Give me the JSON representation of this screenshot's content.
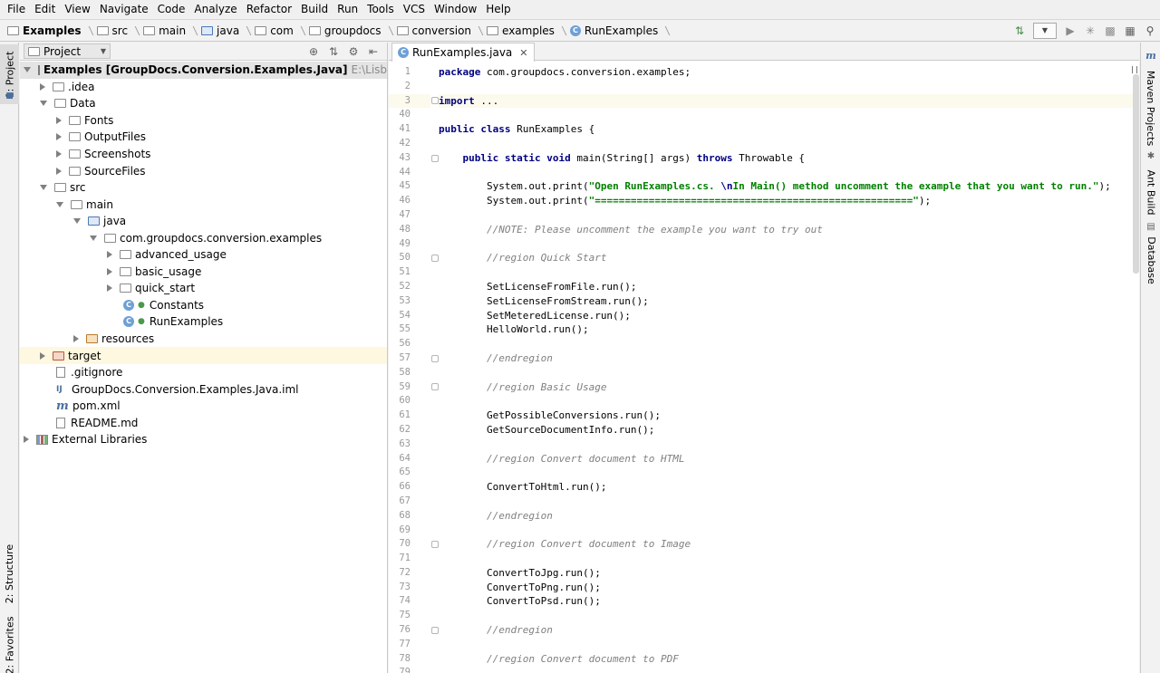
{
  "menu": [
    "File",
    "Edit",
    "View",
    "Navigate",
    "Code",
    "Analyze",
    "Refactor",
    "Build",
    "Run",
    "Tools",
    "VCS",
    "Window",
    "Help"
  ],
  "breadcrumbs": [
    "Examples",
    "src",
    "main",
    "java",
    "com",
    "groupdocs",
    "conversion",
    "examples",
    "RunExamples"
  ],
  "left_tabs": {
    "project": "1: Project",
    "structure": "2: Structure",
    "favorites": "2: Favorites"
  },
  "right_tabs": {
    "maven": "Maven Projects",
    "ant": "Ant Build",
    "database": "Database"
  },
  "project_panel": {
    "view": "Project"
  },
  "tree": [
    {
      "label": "Examples [GroupDocs.Conversion.Examples.Java]",
      "path": "E:\\Lisbon\\Java_product"
    },
    {
      "label": ".idea"
    },
    {
      "label": "Data"
    },
    {
      "label": "Fonts"
    },
    {
      "label": "OutputFiles"
    },
    {
      "label": "Screenshots"
    },
    {
      "label": "SourceFiles"
    },
    {
      "label": "src"
    },
    {
      "label": "main"
    },
    {
      "label": "java"
    },
    {
      "label": "com.groupdocs.conversion.examples"
    },
    {
      "label": "advanced_usage"
    },
    {
      "label": "basic_usage"
    },
    {
      "label": "quick_start"
    },
    {
      "label": "Constants"
    },
    {
      "label": "RunExamples"
    },
    {
      "label": "resources"
    },
    {
      "label": "target"
    },
    {
      "label": ".gitignore"
    },
    {
      "label": "GroupDocs.Conversion.Examples.Java.iml"
    },
    {
      "label": "pom.xml"
    },
    {
      "label": "README.md"
    },
    {
      "label": "External Libraries"
    }
  ],
  "editor": {
    "tab": "RunExamples.java",
    "line_numbers": [
      "1",
      "2",
      "3",
      "40",
      "41",
      "42",
      "43",
      "44",
      "45",
      "46",
      "47",
      "48",
      "49",
      "50",
      "51",
      "52",
      "53",
      "54",
      "55",
      "56",
      "57",
      "58",
      "59",
      "60",
      "61",
      "62",
      "63",
      "64",
      "65",
      "66",
      "67",
      "68",
      "69",
      "70",
      "71",
      "72",
      "73",
      "74",
      "75",
      "76",
      "77",
      "78",
      "79"
    ],
    "code": {
      "l1_kw": "package",
      "l1_rest": " com.groupdocs.conversion.examples;",
      "l3_kw": "import",
      "l3_rest": " ...",
      "l41_kw": "public class",
      "l41_rest": " RunExamples {",
      "l43_kw1": "public static void",
      "l43_mid": " main(String[] args) ",
      "l43_kw2": "throws",
      "l43_rest": " Throwable {",
      "l45_pre": "System.out.print(",
      "l45_str1": "\"Open RunExamples.cs. ",
      "l45_esc": "\\n",
      "l45_str2": "In Main() method uncomment the example that you want to run.\"",
      "l45_post": ");",
      "l46_pre": "System.out.print(",
      "l46_str": "\"=====================================================\"",
      "l46_post": ");",
      "l48": "//NOTE: Please uncomment the example you want to try out",
      "l50": "//region Quick Start",
      "l52": "SetLicenseFromFile.run();",
      "l53": "SetLicenseFromStream.run();",
      "l54": "SetMeteredLicense.run();",
      "l55": "HelloWorld.run();",
      "l57": "//endregion",
      "l59": "//region Basic Usage",
      "l61": "GetPossibleConversions.run();",
      "l62": "GetSourceDocumentInfo.run();",
      "l64": "//region Convert document to HTML",
      "l66": "ConvertToHtml.run();",
      "l68": "//endregion",
      "l70": "//region Convert document to Image",
      "l72": "ConvertToJpg.run();",
      "l73": "ConvertToPng.run();",
      "l74": "ConvertToPsd.run();",
      "l76": "//endregion",
      "l78": "//region Convert document to PDF"
    }
  }
}
